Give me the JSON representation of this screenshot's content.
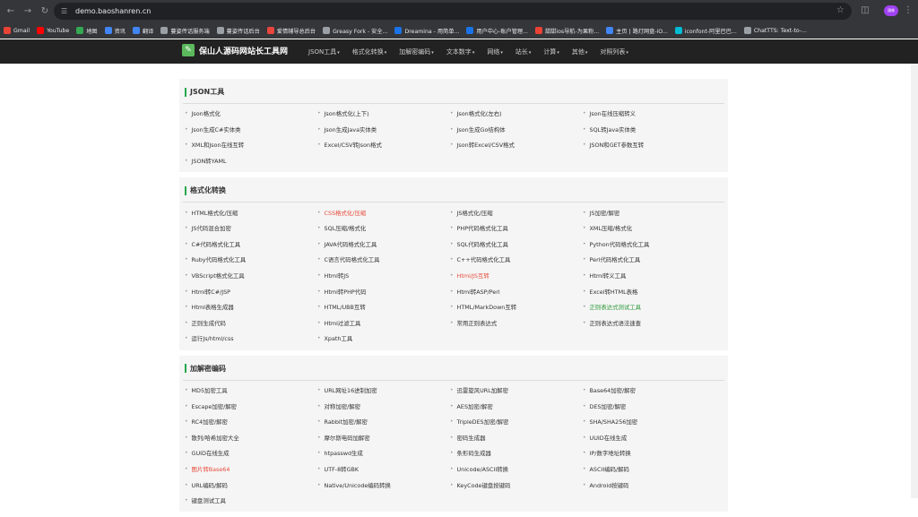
{
  "browser": {
    "url": "demo.baoshanren.cn",
    "profile_label": "頭像"
  },
  "bookmarks": [
    {
      "label": "Gmail",
      "color": "#ea4335"
    },
    {
      "label": "YouTube",
      "color": "#ff0000"
    },
    {
      "label": "地图",
      "color": "#34a853"
    },
    {
      "label": "资讯",
      "color": "#4285f4"
    },
    {
      "label": "翻译",
      "color": "#4285f4"
    },
    {
      "label": "蔓姿传话服务端",
      "color": "#9aa0a6"
    },
    {
      "label": "蔓姿传话后台",
      "color": "#9aa0a6"
    },
    {
      "label": "爱情辅导总后台",
      "color": "#e8453c"
    },
    {
      "label": "Greasy Fork - 安全...",
      "color": "#9aa0a6"
    },
    {
      "label": "Dreamina - 用简单...",
      "color": "#1a73e8"
    },
    {
      "label": "用户中心-账户管理...",
      "color": "#1a73e8"
    },
    {
      "label": "甜甜ios导航-为果粉...",
      "color": "#ea4335"
    },
    {
      "label": "主页 | 路灯网盘-iO...",
      "color": "#4285f4"
    },
    {
      "label": "iconfont-阿里巴巴...",
      "color": "#00bcd4"
    },
    {
      "label": "ChatTTS: Text-to-...",
      "color": "#9aa0a6"
    }
  ],
  "site": {
    "title": "保山人源码网站长工具网",
    "menu": [
      {
        "label": "JSON工具"
      },
      {
        "label": "格式化转换"
      },
      {
        "label": "加解密编码"
      },
      {
        "label": "文本数字"
      },
      {
        "label": "网络"
      },
      {
        "label": "站长"
      },
      {
        "label": "计算"
      },
      {
        "label": "其他"
      },
      {
        "label": "对照列表"
      }
    ]
  },
  "sections": [
    {
      "title": "JSON工具",
      "links": [
        {
          "label": "Json格式化"
        },
        {
          "label": "Json格式化(上下)"
        },
        {
          "label": "Json格式化(左右)"
        },
        {
          "label": "Json在线压缩转义"
        },
        {
          "label": "Json生成C#实体类"
        },
        {
          "label": "Json生成Java实体类"
        },
        {
          "label": "Json生成Go结构体"
        },
        {
          "label": "SQL转Java实体类"
        },
        {
          "label": "XML和Json在线互转"
        },
        {
          "label": "Excel/CSV转Json格式"
        },
        {
          "label": "Json转Excel/CSV格式"
        },
        {
          "label": "JSON和GET参数互转"
        },
        {
          "label": "JSON转YAML"
        }
      ]
    },
    {
      "title": "格式化转换",
      "links": [
        {
          "label": "HTML格式化/压缩"
        },
        {
          "label": "CSS格式化/压缩",
          "color": "red"
        },
        {
          "label": "JS格式化/压缩"
        },
        {
          "label": "JS加密/解密"
        },
        {
          "label": "JS代码混合加密"
        },
        {
          "label": "SQL压缩/格式化"
        },
        {
          "label": "PHP代码格式化工具"
        },
        {
          "label": "XML压缩/格式化"
        },
        {
          "label": "C#代码格式化工具"
        },
        {
          "label": "JAVA代码格式化工具"
        },
        {
          "label": "SQL代码格式化工具"
        },
        {
          "label": "Python代码格式化工具"
        },
        {
          "label": "Ruby代码格式化工具"
        },
        {
          "label": "C语言代码格式化工具"
        },
        {
          "label": "C++代码格式化工具"
        },
        {
          "label": "Perl代码格式化工具"
        },
        {
          "label": "VBScript格式化工具"
        },
        {
          "label": "Html转JS"
        },
        {
          "label": "Html/JS互转",
          "color": "red"
        },
        {
          "label": "Html转义工具"
        },
        {
          "label": "Html转C#/JSP"
        },
        {
          "label": "Html转PHP代码"
        },
        {
          "label": "Html转ASP/Perl"
        },
        {
          "label": "Excel转HTML表格"
        },
        {
          "label": "Html表格生成器"
        },
        {
          "label": "HTML/UBB互转"
        },
        {
          "label": "HTML/MarkDown互转"
        },
        {
          "label": "正则表达式测试工具",
          "color": "green"
        },
        {
          "label": "正则生成代码"
        },
        {
          "label": "Html过滤工具"
        },
        {
          "label": "常用正则表达式"
        },
        {
          "label": "正则表达式语法速查"
        },
        {
          "label": "运行Js/html/css"
        },
        {
          "label": "Xpath工具"
        }
      ]
    },
    {
      "title": "加解密编码",
      "links": [
        {
          "label": "MD5加密工具"
        },
        {
          "label": "URL网址16进制加密"
        },
        {
          "label": "迅雷旋风URL加解密"
        },
        {
          "label": "Base64加密/解密"
        },
        {
          "label": "Escape加密/解密"
        },
        {
          "label": "对称加密/解密"
        },
        {
          "label": "AES加密/解密"
        },
        {
          "label": "DES加密/解密"
        },
        {
          "label": "RC4加密/解密"
        },
        {
          "label": "Rabbit加密/解密"
        },
        {
          "label": "TripleDES加密/解密"
        },
        {
          "label": "SHA/SHA256加密"
        },
        {
          "label": "散列/哈希加密大全"
        },
        {
          "label": "摩尔斯电码加解密"
        },
        {
          "label": "密码生成器"
        },
        {
          "label": "UUID在线生成"
        },
        {
          "label": "GUID在线生成"
        },
        {
          "label": "htpasswd生成"
        },
        {
          "label": "条形码生成器"
        },
        {
          "label": "IP/数字地址转换"
        },
        {
          "label": "图片转Base64",
          "color": "red"
        },
        {
          "label": "UTF-8转GBK"
        },
        {
          "label": "Unicode/ASCII转换"
        },
        {
          "label": "ASCII编码/解码"
        },
        {
          "label": "URL编码/解码"
        },
        {
          "label": "Native/Unicode编码转换"
        },
        {
          "label": "KeyCode键盘按键码"
        },
        {
          "label": "Android按键码"
        },
        {
          "label": "键盘测试工具"
        }
      ]
    }
  ]
}
